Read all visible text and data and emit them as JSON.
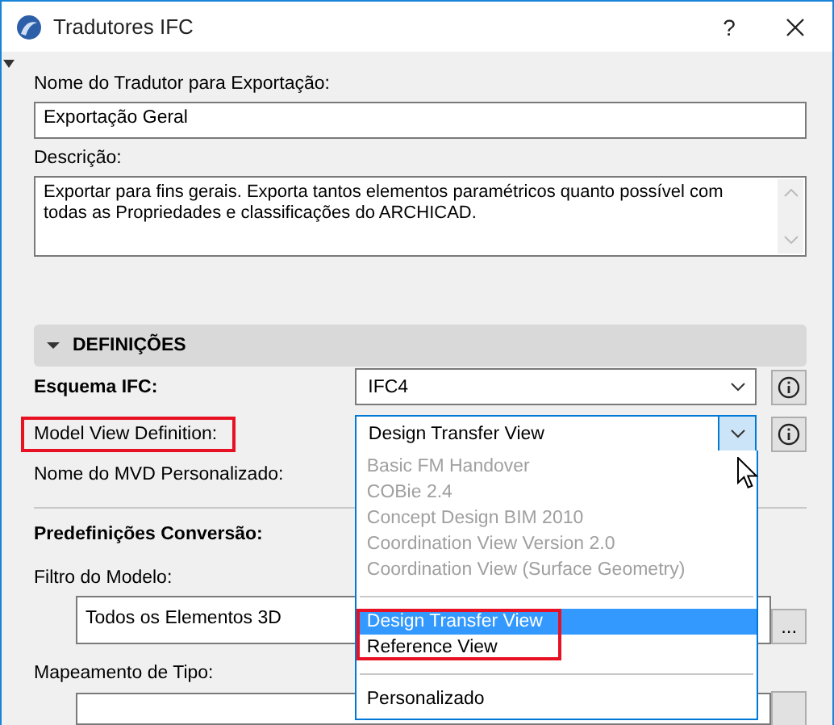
{
  "window": {
    "title": "Tradutores IFC",
    "help_button": "?"
  },
  "translator_name": {
    "label": "Nome do Tradutor para Exportação:",
    "value": "Exportação Geral"
  },
  "description": {
    "label": "Descrição:",
    "value": "Exportar para fins gerais. Exporta tantos elementos paramétricos quanto possível com todas as Propriedades e classificações do ARCHICAD."
  },
  "section": {
    "title": "DEFINIÇÕES",
    "expanded": true
  },
  "ifc_schema": {
    "label": "Esquema IFC:",
    "value": "IFC4"
  },
  "model_view_definition": {
    "label": "Model View Definition:",
    "value": "Design Transfer View",
    "open": true,
    "highlighted": true,
    "options": [
      {
        "kind": "option",
        "label": "Basic FM Handover",
        "disabled": true,
        "selected": false,
        "highlighted": false
      },
      {
        "kind": "option",
        "label": "COBie 2.4",
        "disabled": true,
        "selected": false,
        "highlighted": false
      },
      {
        "kind": "option",
        "label": "Concept Design BIM 2010",
        "disabled": true,
        "selected": false,
        "highlighted": false
      },
      {
        "kind": "option",
        "label": "Coordination View Version 2.0",
        "disabled": true,
        "selected": false,
        "highlighted": false
      },
      {
        "kind": "option",
        "label": "Coordination View (Surface Geometry)",
        "disabled": true,
        "selected": false,
        "highlighted": false
      },
      {
        "kind": "separator"
      },
      {
        "kind": "option",
        "label": "Design Transfer View",
        "disabled": false,
        "selected": true,
        "highlighted": true
      },
      {
        "kind": "option",
        "label": "Reference View",
        "disabled": false,
        "selected": false,
        "highlighted": true
      },
      {
        "kind": "separator"
      },
      {
        "kind": "option",
        "label": "Personalizado",
        "disabled": false,
        "selected": false,
        "highlighted": false
      }
    ]
  },
  "custom_mvd_name": {
    "label": "Nome do MVD Personalizado:"
  },
  "conversion_presets": {
    "title": "Predefinições Conversão:"
  },
  "model_filter": {
    "label": "Filtro do Modelo:",
    "value": "Todos os Elementos 3D",
    "button": "..."
  },
  "type_mapping": {
    "label": "Mapeamento de Tipo:"
  }
}
